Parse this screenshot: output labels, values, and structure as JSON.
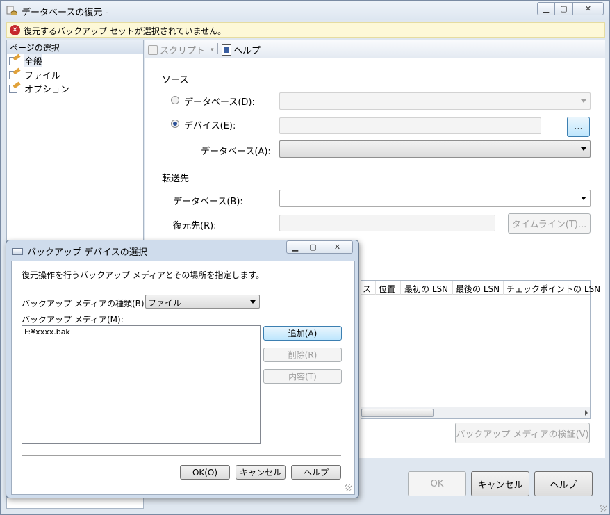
{
  "window": {
    "title": "データベースの復元 -",
    "error_icon": "error-icon",
    "error_message": "復元するバックアップ セットが選択されていません。"
  },
  "left": {
    "header": "ページの選択",
    "items": [
      {
        "label": "全般"
      },
      {
        "label": "ファイル"
      },
      {
        "label": "オプション"
      }
    ]
  },
  "toolbar": {
    "script": "スクリプト",
    "help": "ヘルプ"
  },
  "source": {
    "group": "ソース",
    "database_label": "データベース(D):",
    "device_label": "デバイス(E):",
    "browse": "...",
    "db_label": "データベース(A):"
  },
  "dest": {
    "group": "転送先",
    "database_label": "データベース(B):",
    "restore_to_label": "復元先(R):",
    "timeline": "タイムライン(T)..."
  },
  "grid": {
    "columns": [
      "ス",
      "位置",
      "最初の LSN",
      "最後の LSN",
      "チェックポイントの LSN"
    ]
  },
  "verify": "バックアップ メディアの検証(V)",
  "buttons": {
    "ok": "OK",
    "cancel": "キャンセル",
    "help": "ヘルプ"
  },
  "dialog": {
    "title": "バックアップ デバイスの選択",
    "instruction": "復元操作を行うバックアップ メディアとその場所を指定します。",
    "media_type_label": "バックアップ メディアの種類(B):",
    "media_type_value": "ファイル",
    "media_label": "バックアップ メディア(M):",
    "media_items": [
      "F:¥xxxx.bak"
    ],
    "add": "追加(A)",
    "remove": "削除(R)",
    "contents": "内容(T)",
    "ok": "OK(O)",
    "cancel": "キャンセル",
    "help": "ヘルプ"
  }
}
